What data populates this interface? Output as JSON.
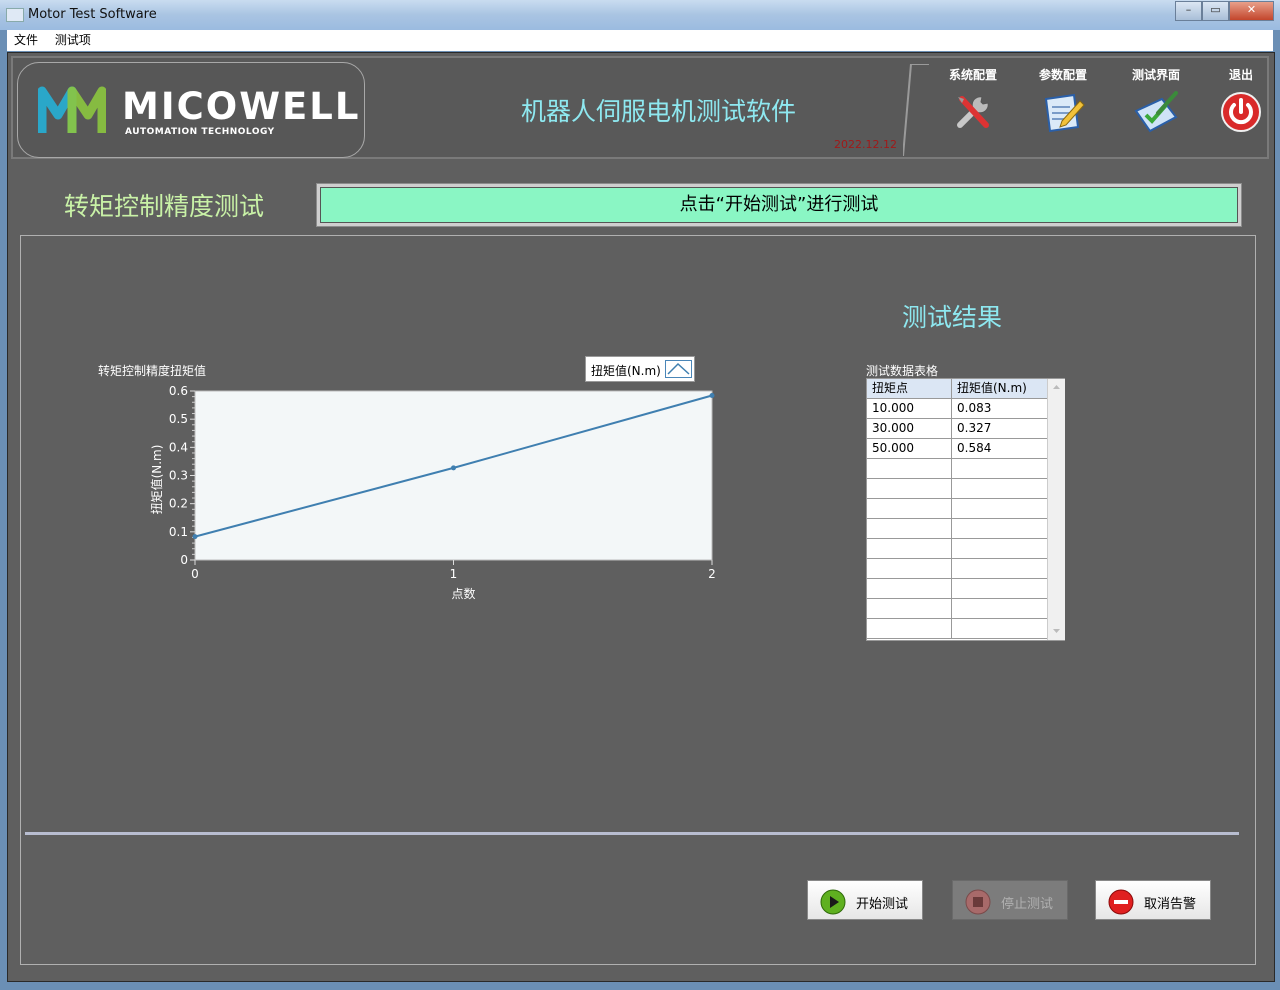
{
  "window": {
    "title": "Motor Test Software",
    "min": "–",
    "max": "▭",
    "close": "✕"
  },
  "menu": [
    "文件",
    "测试项"
  ],
  "header": {
    "brand": "MICOWELL",
    "brand_sub": "AUTOMATION TECHNOLOGY",
    "app_title": "机器人伺服电机测试软件",
    "date": "2022.12.12",
    "nav": [
      {
        "label": "系统配置",
        "icon": "tools-icon"
      },
      {
        "label": "参数配置",
        "icon": "edit-document-icon"
      },
      {
        "label": "测试界面",
        "icon": "clipboard-check-icon"
      },
      {
        "label": "退出",
        "icon": "power-icon"
      }
    ]
  },
  "section_title": "转矩控制精度测试",
  "status_text": "点击“开始测试”进行测试",
  "results_title": "测试结果",
  "chart_data": {
    "type": "line",
    "title": "转矩控制精度扭矩值",
    "xlabel": "点数",
    "ylabel": "扭矩值(N.m)",
    "x": [
      0,
      1,
      2
    ],
    "series": [
      {
        "name": "扭矩值(N.m)",
        "values": [
          0.083,
          0.327,
          0.584
        ]
      }
    ],
    "xlim": [
      0,
      2
    ],
    "ylim": [
      0,
      0.6
    ],
    "xticks": [
      "0",
      "1",
      "2"
    ],
    "yticks": [
      "0",
      "0.1",
      "0.2",
      "0.3",
      "0.4",
      "0.5",
      "0.6"
    ],
    "grid": false,
    "legend": "top-right",
    "line_color": "#3f7fb0",
    "plot_bg": "#f3f7f8"
  },
  "table": {
    "title": "测试数据表格",
    "headers": [
      "扭矩点",
      "扭矩值(N.m)"
    ],
    "rows": [
      [
        "10.000",
        "0.083"
      ],
      [
        "30.000",
        "0.327"
      ],
      [
        "50.000",
        "0.584"
      ]
    ]
  },
  "buttons": {
    "start": "开始测试",
    "stop": "停止测试",
    "cancel_alarm": "取消告警"
  }
}
